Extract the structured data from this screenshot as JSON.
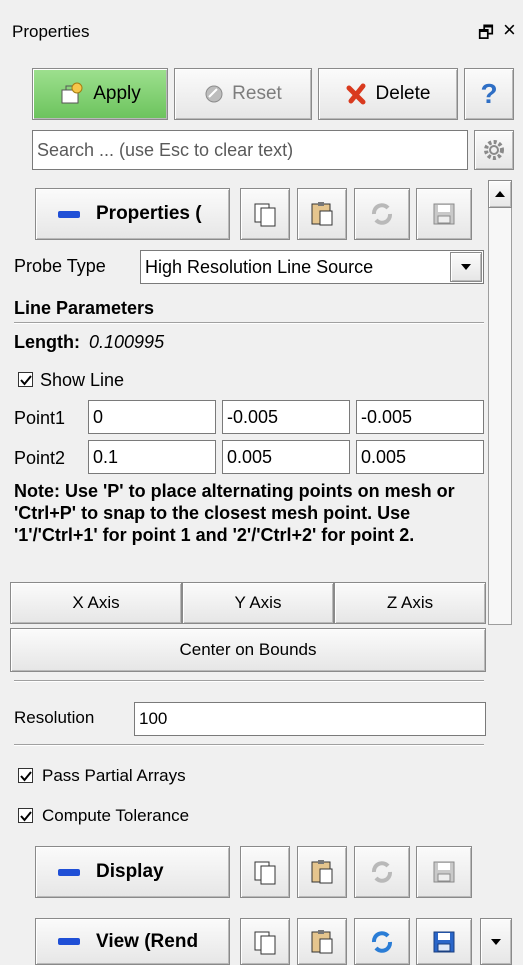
{
  "panel": {
    "title": "Properties",
    "float_glyph": "🗗",
    "close_glyph": "×"
  },
  "toolbar": {
    "apply": "Apply",
    "reset": "Reset",
    "delete": "Delete",
    "help": "?"
  },
  "search": {
    "placeholder": "Search ... (use Esc to clear text)"
  },
  "properties_section": {
    "label": "Properties ("
  },
  "probe": {
    "label": "Probe Type",
    "value": "High Resolution Line Source"
  },
  "line_params": {
    "heading": "Line Parameters",
    "length_label": "Length:",
    "length_value": "0.100995",
    "show_line": "Show Line",
    "point1_label": "Point1",
    "point1": [
      "0",
      "-0.005",
      "-0.005"
    ],
    "point2_label": "Point2",
    "point2": [
      "0.1",
      "0.005",
      "0.005"
    ],
    "note": "Note: Use 'P' to place alternating points on mesh or 'Ctrl+P' to snap to the closest mesh point. Use '1'/'Ctrl+1' for point 1 and '2'/'Ctrl+2' for point 2.",
    "x_axis": "X Axis",
    "y_axis": "Y Axis",
    "z_axis": "Z Axis",
    "center_on_bounds": "Center on Bounds"
  },
  "resolution": {
    "label": "Resolution",
    "value": "100"
  },
  "options": {
    "pass_partial_arrays": "Pass Partial Arrays",
    "compute_tolerance": "Compute Tolerance"
  },
  "display_section": {
    "label": "Display"
  },
  "view_section": {
    "label": "View (Rend"
  },
  "colors": {
    "apply_green": "#7ccf6e",
    "minus_blue": "#1f4fd6",
    "delete_red": "#d93a1e"
  }
}
